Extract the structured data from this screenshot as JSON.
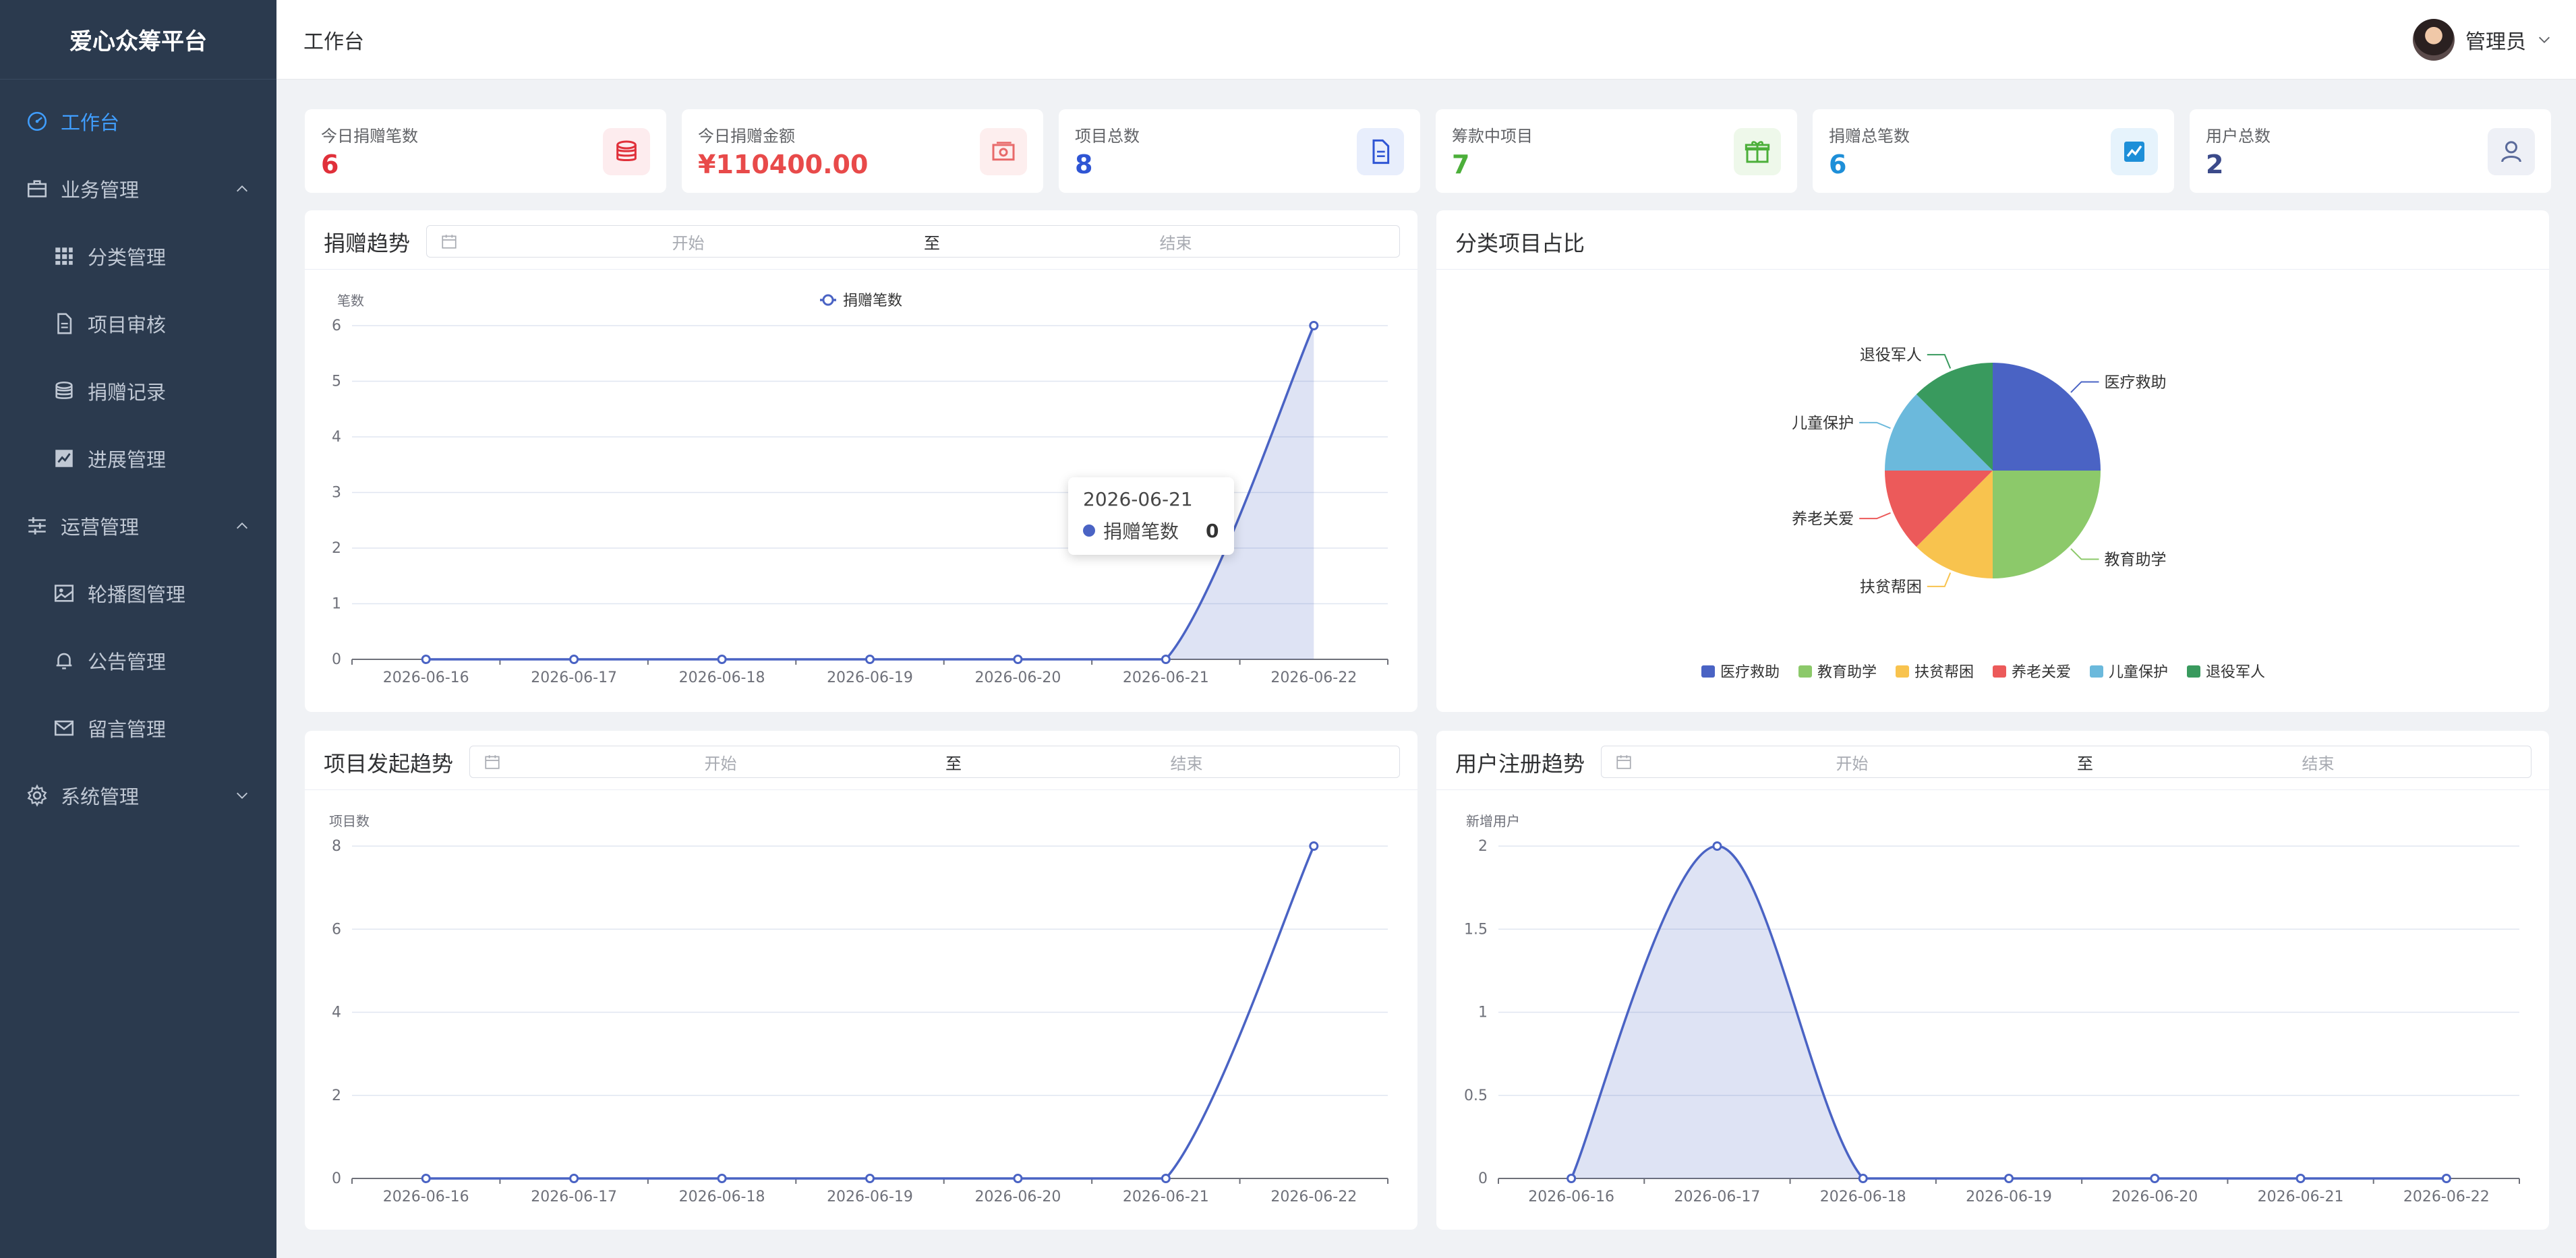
{
  "app": {
    "title": "爱心众筹平台"
  },
  "header": {
    "title": "工作台",
    "user_name": "管理员"
  },
  "sidebar": {
    "items": [
      {
        "label": "工作台",
        "level": 0,
        "active": true,
        "icon": "dashboard-icon"
      },
      {
        "label": "业务管理",
        "level": 0,
        "expanded": true,
        "icon": "briefcase-icon"
      },
      {
        "label": "分类管理",
        "level": 1,
        "icon": "grid-icon"
      },
      {
        "label": "项目审核",
        "level": 1,
        "icon": "document-icon"
      },
      {
        "label": "捐赠记录",
        "level": 1,
        "icon": "coins-icon"
      },
      {
        "label": "进展管理",
        "level": 1,
        "icon": "trend-icon"
      },
      {
        "label": "运营管理",
        "level": 0,
        "expanded": true,
        "icon": "sliders-icon"
      },
      {
        "label": "轮播图管理",
        "level": 1,
        "icon": "image-icon"
      },
      {
        "label": "公告管理",
        "level": 1,
        "icon": "bell-icon"
      },
      {
        "label": "留言管理",
        "level": 1,
        "icon": "mail-icon"
      },
      {
        "label": "系统管理",
        "level": 0,
        "expanded": false,
        "icon": "gear-icon"
      }
    ]
  },
  "stats": [
    {
      "label": "今日捐赠笔数",
      "value": "6",
      "color": "#e0303a",
      "icon": "coins-icon",
      "icon_color": "#e0303a",
      "icon_bg": "#fdecee"
    },
    {
      "label": "今日捐赠金额",
      "value": "¥110400.00",
      "color": "#e84a4a",
      "icon": "money-icon",
      "icon_color": "#e86a6a",
      "icon_bg": "#fdeeee"
    },
    {
      "label": "项目总数",
      "value": "8",
      "color": "#2f55d4",
      "icon": "document-icon",
      "icon_color": "#2f55d4",
      "icon_bg": "#e8eefc"
    },
    {
      "label": "筹款中项目",
      "value": "7",
      "color": "#4caf3a",
      "icon": "gift-icon",
      "icon_color": "#4caf3a",
      "icon_bg": "#eef8ea"
    },
    {
      "label": "捐赠总笔数",
      "value": "6",
      "color": "#1e8fd8",
      "icon": "chart-icon",
      "icon_color": "#1e8fd8",
      "icon_bg": "#e6f3fc"
    },
    {
      "label": "用户总数",
      "value": "2",
      "color": "#3b4a8a",
      "icon": "user-icon",
      "icon_color": "#5a6a9a",
      "icon_bg": "#eef0f6"
    }
  ],
  "range": {
    "start_placeholder": "开始",
    "end_placeholder": "结束",
    "separator": "至"
  },
  "panels": {
    "donation_trend": {
      "title": "捐赠趋势"
    },
    "category_share": {
      "title": "分类项目占比"
    },
    "project_trend": {
      "title": "项目发起趋势"
    },
    "user_trend": {
      "title": "用户注册趋势"
    }
  },
  "tooltip": {
    "date": "2026-06-21",
    "series": "捐赠笔数",
    "value": "0"
  },
  "chart_data": [
    {
      "type": "area",
      "ylabel": "笔数",
      "categories": [
        "2026-06-16",
        "2026-06-17",
        "2026-06-18",
        "2026-06-19",
        "2026-06-20",
        "2026-06-21",
        "2026-06-22"
      ],
      "series": [
        {
          "name": "捐赠笔数",
          "values": [
            0,
            0,
            0,
            0,
            0,
            0,
            6
          ]
        }
      ],
      "ylim": [
        0,
        6
      ],
      "yticks": [
        0,
        1,
        2,
        3,
        4,
        5,
        6
      ],
      "legend": "top-center",
      "grid": true,
      "color": "#4a63c4"
    },
    {
      "type": "pie",
      "slices": [
        {
          "label": "医疗救助",
          "value": 2,
          "color": "#4a63c4"
        },
        {
          "label": "教育助学",
          "value": 2,
          "color": "#8cc96a"
        },
        {
          "label": "扶贫帮困",
          "value": 1,
          "color": "#f8c34e"
        },
        {
          "label": "养老关爱",
          "value": 1,
          "color": "#ec5a5a"
        },
        {
          "label": "儿童保护",
          "value": 1,
          "color": "#6bb9dc"
        },
        {
          "label": "退役军人",
          "value": 1,
          "color": "#399a5e"
        }
      ],
      "legend": "bottom-center"
    },
    {
      "type": "line",
      "ylabel": "项目数",
      "categories": [
        "2026-06-16",
        "2026-06-17",
        "2026-06-18",
        "2026-06-19",
        "2026-06-20",
        "2026-06-21",
        "2026-06-22"
      ],
      "series": [
        {
          "values": [
            0,
            0,
            0,
            0,
            0,
            0,
            8
          ]
        }
      ],
      "ylim": [
        0,
        8
      ],
      "yticks": [
        0,
        2,
        4,
        6,
        8
      ],
      "grid": true,
      "color": "#4a63c4"
    },
    {
      "type": "area",
      "ylabel": "新增用户",
      "categories": [
        "2026-06-16",
        "2026-06-17",
        "2026-06-18",
        "2026-06-19",
        "2026-06-20",
        "2026-06-21",
        "2026-06-22"
      ],
      "series": [
        {
          "values": [
            0,
            2,
            0,
            0,
            0,
            0,
            0
          ]
        }
      ],
      "ylim": [
        0,
        2
      ],
      "yticks": [
        0,
        0.5,
        1,
        1.5,
        2
      ],
      "grid": true,
      "color": "#4a63c4"
    }
  ]
}
